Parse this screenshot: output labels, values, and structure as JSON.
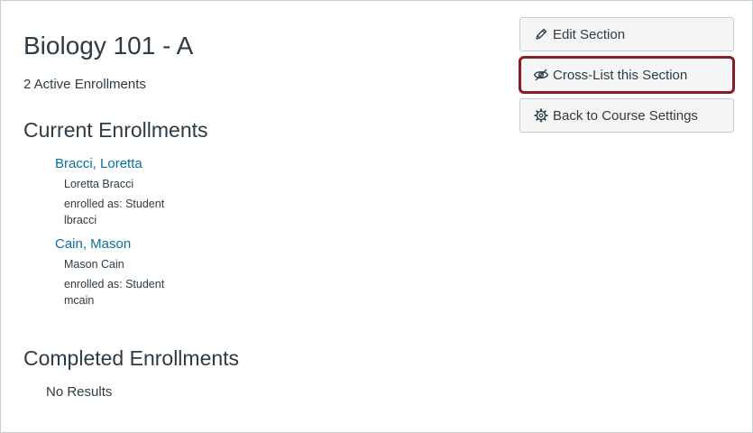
{
  "section": {
    "title": "Biology 101 - A",
    "active_enrollments": "2 Active Enrollments"
  },
  "current_enrollments": {
    "heading": "Current Enrollments",
    "items": [
      {
        "link": "Bracci, Loretta",
        "name": "Loretta Bracci",
        "role": "enrolled as: Student",
        "login": "lbracci"
      },
      {
        "link": "Cain, Mason",
        "name": "Mason Cain",
        "role": "enrolled as: Student",
        "login": "mcain"
      }
    ]
  },
  "completed_enrollments": {
    "heading": "Completed Enrollments",
    "empty_text": "No Results"
  },
  "sidebar": {
    "edit_label": "Edit Section",
    "crosslist_label": "Cross-List this Section",
    "back_label": "Back to Course Settings",
    "highlight_color": "#8a1c24",
    "link_color": "#0770a3"
  }
}
